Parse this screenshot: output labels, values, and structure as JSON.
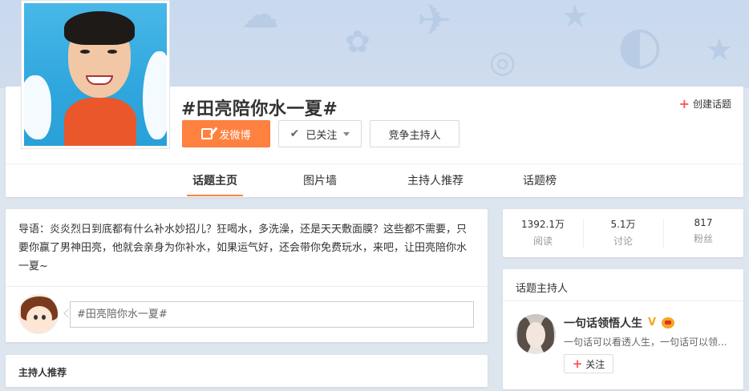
{
  "topic": {
    "title": "#田亮陪你水一夏#",
    "create_label": "创建话题"
  },
  "actions": {
    "post_label": "发微博",
    "follow_label": "已关注",
    "host_label": "竞争主持人"
  },
  "tabs": [
    {
      "label": "话题主页",
      "active": true
    },
    {
      "label": "图片墙",
      "active": false
    },
    {
      "label": "主持人推荐",
      "active": false
    },
    {
      "label": "话题榜",
      "active": false
    }
  ],
  "intro": {
    "text": "导语：炎炎烈日到底都有什么补水妙招儿？狂喝水，多洗澡，还是天天敷面膜？这些都不需要，只要你赢了男神田亮，他就会亲身为你补水，如果运气好，还会带你免费玩水，来吧，让田亮陪你水一夏~"
  },
  "compose": {
    "placeholder": "#田亮陪你水一夏#"
  },
  "host_recommend": {
    "title": "主持人推荐"
  },
  "stats": [
    {
      "value": "1392.1万",
      "label": "阅读"
    },
    {
      "value": "5.1万",
      "label": "讨论"
    },
    {
      "value": "817",
      "label": "粉丝"
    }
  ],
  "host": {
    "section_title": "话题主持人",
    "name": "一句话领悟人生",
    "desc": "一句话可以看透人生，一句话可以领...",
    "follow_label": "关注"
  },
  "colors": {
    "accent": "#ff8140",
    "plus": "#ff5555"
  }
}
